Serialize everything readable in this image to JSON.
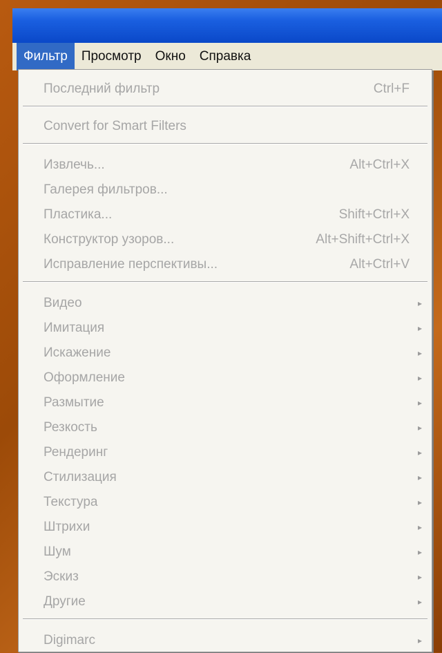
{
  "menubar": {
    "items": [
      {
        "label": "Фильтр"
      },
      {
        "label": "Просмотр"
      },
      {
        "label": "Окно"
      },
      {
        "label": "Справка"
      }
    ]
  },
  "dropdown": {
    "last_filter": {
      "label": "Последний фильтр",
      "shortcut": "Ctrl+F"
    },
    "smart_filters": {
      "label": "Convert for Smart Filters"
    },
    "extract": {
      "label": "Извлечь...",
      "shortcut": "Alt+Ctrl+X"
    },
    "filter_gallery": {
      "label": "Галерея фильтров..."
    },
    "liquify": {
      "label": "Пластика...",
      "shortcut": "Shift+Ctrl+X"
    },
    "pattern_maker": {
      "label": "Конструктор узоров...",
      "shortcut": "Alt+Shift+Ctrl+X"
    },
    "vanishing_point": {
      "label": "Исправление перспективы...",
      "shortcut": "Alt+Ctrl+V"
    },
    "submenus": [
      {
        "label": "Видео"
      },
      {
        "label": "Имитация"
      },
      {
        "label": "Искажение"
      },
      {
        "label": "Оформление"
      },
      {
        "label": "Размытие"
      },
      {
        "label": "Резкость"
      },
      {
        "label": "Рендеринг"
      },
      {
        "label": "Стилизация"
      },
      {
        "label": "Текстура"
      },
      {
        "label": "Штрихи"
      },
      {
        "label": "Шум"
      },
      {
        "label": "Эскиз"
      },
      {
        "label": "Другие"
      }
    ],
    "digimarc": {
      "label": "Digimarc"
    },
    "arrow_glyph": "▸"
  },
  "colors": {
    "titlebar": "#0a48c8",
    "menu_active": "#316ac5",
    "menu_bg": "#ece9d8",
    "disabled_text": "#a6a6a6"
  }
}
